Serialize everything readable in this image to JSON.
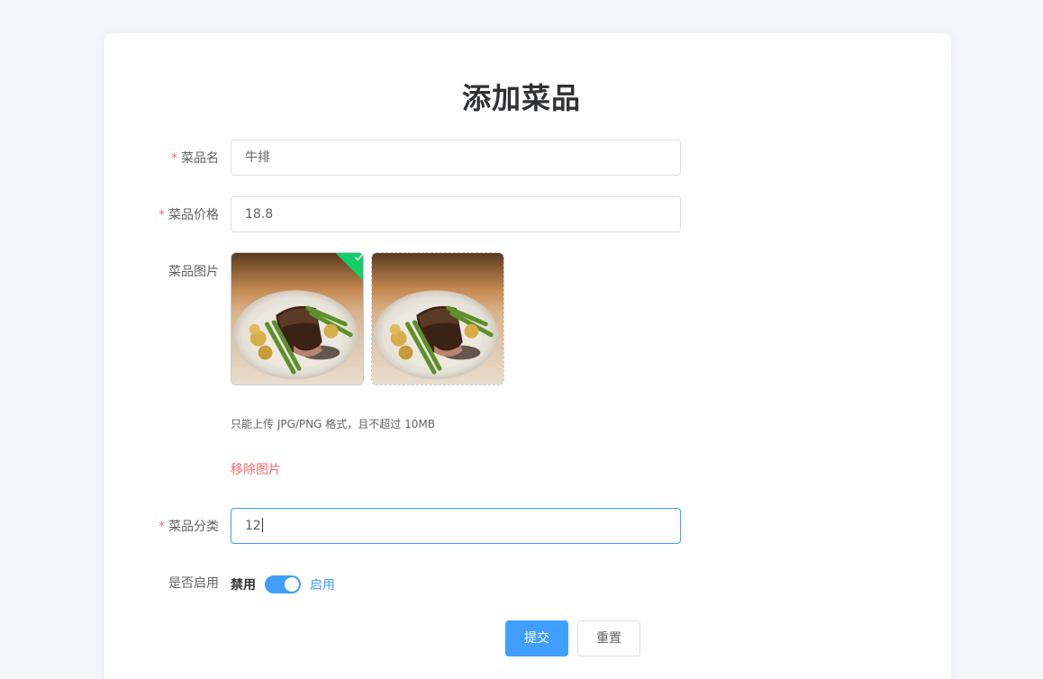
{
  "page": {
    "title": "添加菜品"
  },
  "form": {
    "name": {
      "label": "菜品名",
      "value": "牛排",
      "required": true
    },
    "price": {
      "label": "菜品价格",
      "value": "18.8",
      "required": true
    },
    "image": {
      "label": "菜品图片",
      "tip": "只能上传 JPG/PNG 格式，且不超过 10MB",
      "remove_label": "移除图片"
    },
    "category": {
      "label": "菜品分类",
      "value": "12",
      "required": true
    },
    "enabled": {
      "label": "是否启用",
      "off_text": "禁用",
      "on_text": "启用",
      "value": true
    },
    "required_mark": "*"
  },
  "actions": {
    "submit_label": "提交",
    "reset_label": "重置"
  },
  "colors": {
    "primary": "#409eff",
    "danger": "#f56c6c",
    "success": "#13ce66",
    "text": "#606266"
  },
  "icons": {
    "upload_success": "check-icon",
    "dish_photo": "steak-photo"
  }
}
